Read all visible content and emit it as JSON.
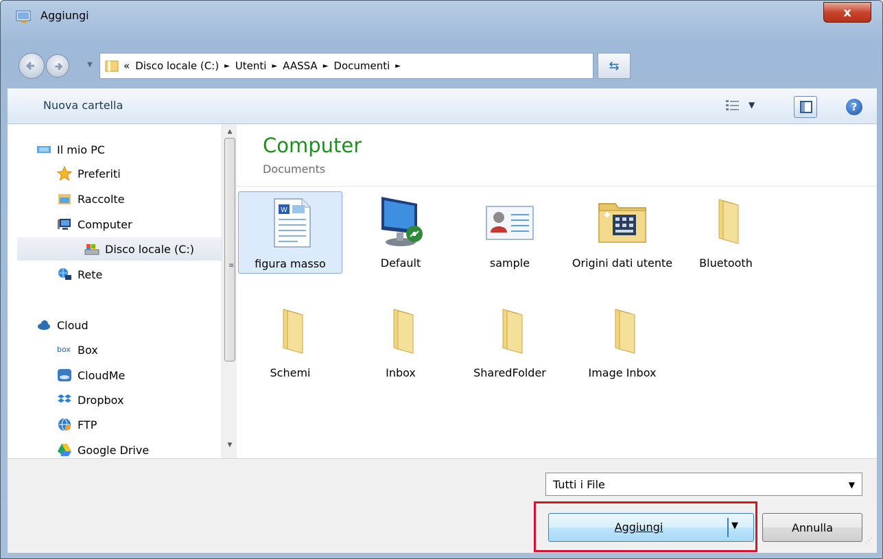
{
  "window": {
    "title": "Aggiungi",
    "close_label": "x"
  },
  "address": {
    "prefix": "«",
    "crumbs": [
      "Disco locale (C:)",
      "Utenti",
      "AASSA",
      "Documenti"
    ],
    "sep": "►"
  },
  "toolbar": {
    "new_folder": "Nuova cartella"
  },
  "nav": {
    "items": [
      {
        "label": "Il mio PC",
        "icon": "pc-icon"
      },
      {
        "label": "Preferiti",
        "icon": "star-icon"
      },
      {
        "label": "Raccolte",
        "icon": "library-icon"
      },
      {
        "label": "Computer",
        "icon": "computer-icon"
      },
      {
        "label": "Disco locale (C:)",
        "icon": "drive-icon"
      },
      {
        "label": "Rete",
        "icon": "network-icon"
      },
      {
        "label": "Cloud",
        "icon": "cloud-icon"
      },
      {
        "label": "Box",
        "icon": "box-icon",
        "icon_text": "box"
      },
      {
        "label": "CloudMe",
        "icon": "cloudme-icon"
      },
      {
        "label": "Dropbox",
        "icon": "dropbox-icon"
      },
      {
        "label": "FTP",
        "icon": "ftp-icon"
      },
      {
        "label": "Google Drive",
        "icon": "google-drive-icon"
      }
    ],
    "selected": "Disco locale (C:)"
  },
  "content": {
    "title": "Computer",
    "subtitle": "Documents",
    "items": [
      {
        "label": "figura masso",
        "icon": "word-document-icon",
        "selected": true
      },
      {
        "label": "Default",
        "icon": "remote-desktop-icon"
      },
      {
        "label": "sample",
        "icon": "contact-card-icon"
      },
      {
        "label": "Origini dati utente",
        "icon": "data-source-folder-icon"
      },
      {
        "label": "Bluetooth",
        "icon": "folder-icon"
      },
      {
        "label": "Schemi",
        "icon": "folder-icon"
      },
      {
        "label": "Inbox",
        "icon": "folder-icon"
      },
      {
        "label": "SharedFolder",
        "icon": "folder-icon"
      },
      {
        "label": "Image Inbox",
        "icon": "folder-icon"
      }
    ]
  },
  "footer": {
    "file_type": "Tutti i File",
    "add_label": "Aggiungi",
    "cancel_label": "Annulla"
  },
  "colors": {
    "accent": "#1e8e1e",
    "highlight": "#d4142a",
    "selection": "#dcebfc"
  }
}
